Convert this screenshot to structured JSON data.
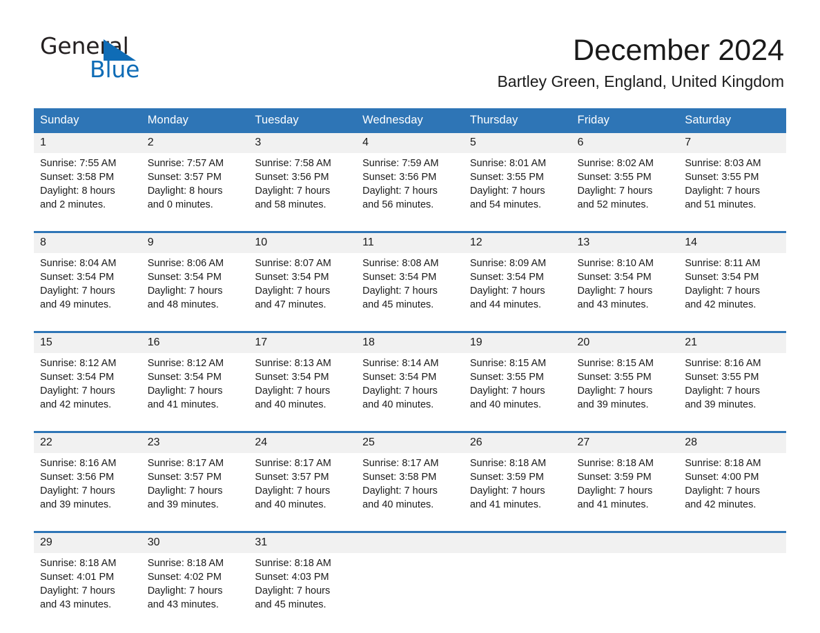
{
  "brand": {
    "name_part1": "General",
    "name_part2": "Blue",
    "accent_color": "#0f6cb6"
  },
  "header": {
    "title": "December 2024",
    "location": "Bartley Green, England, United Kingdom"
  },
  "theme": {
    "header_blue": "#2e75b6",
    "daynum_band": "#f1f1f1",
    "text": "#1a1a1a"
  },
  "weekday_headers": [
    "Sunday",
    "Monday",
    "Tuesday",
    "Wednesday",
    "Thursday",
    "Friday",
    "Saturday"
  ],
  "weeks": [
    {
      "days": [
        {
          "num": "1",
          "sunrise": "Sunrise: 7:55 AM",
          "sunset": "Sunset: 3:58 PM",
          "daylight1": "Daylight: 8 hours",
          "daylight2": "and 2 minutes."
        },
        {
          "num": "2",
          "sunrise": "Sunrise: 7:57 AM",
          "sunset": "Sunset: 3:57 PM",
          "daylight1": "Daylight: 8 hours",
          "daylight2": "and 0 minutes."
        },
        {
          "num": "3",
          "sunrise": "Sunrise: 7:58 AM",
          "sunset": "Sunset: 3:56 PM",
          "daylight1": "Daylight: 7 hours",
          "daylight2": "and 58 minutes."
        },
        {
          "num": "4",
          "sunrise": "Sunrise: 7:59 AM",
          "sunset": "Sunset: 3:56 PM",
          "daylight1": "Daylight: 7 hours",
          "daylight2": "and 56 minutes."
        },
        {
          "num": "5",
          "sunrise": "Sunrise: 8:01 AM",
          "sunset": "Sunset: 3:55 PM",
          "daylight1": "Daylight: 7 hours",
          "daylight2": "and 54 minutes."
        },
        {
          "num": "6",
          "sunrise": "Sunrise: 8:02 AM",
          "sunset": "Sunset: 3:55 PM",
          "daylight1": "Daylight: 7 hours",
          "daylight2": "and 52 minutes."
        },
        {
          "num": "7",
          "sunrise": "Sunrise: 8:03 AM",
          "sunset": "Sunset: 3:55 PM",
          "daylight1": "Daylight: 7 hours",
          "daylight2": "and 51 minutes."
        }
      ]
    },
    {
      "days": [
        {
          "num": "8",
          "sunrise": "Sunrise: 8:04 AM",
          "sunset": "Sunset: 3:54 PM",
          "daylight1": "Daylight: 7 hours",
          "daylight2": "and 49 minutes."
        },
        {
          "num": "9",
          "sunrise": "Sunrise: 8:06 AM",
          "sunset": "Sunset: 3:54 PM",
          "daylight1": "Daylight: 7 hours",
          "daylight2": "and 48 minutes."
        },
        {
          "num": "10",
          "sunrise": "Sunrise: 8:07 AM",
          "sunset": "Sunset: 3:54 PM",
          "daylight1": "Daylight: 7 hours",
          "daylight2": "and 47 minutes."
        },
        {
          "num": "11",
          "sunrise": "Sunrise: 8:08 AM",
          "sunset": "Sunset: 3:54 PM",
          "daylight1": "Daylight: 7 hours",
          "daylight2": "and 45 minutes."
        },
        {
          "num": "12",
          "sunrise": "Sunrise: 8:09 AM",
          "sunset": "Sunset: 3:54 PM",
          "daylight1": "Daylight: 7 hours",
          "daylight2": "and 44 minutes."
        },
        {
          "num": "13",
          "sunrise": "Sunrise: 8:10 AM",
          "sunset": "Sunset: 3:54 PM",
          "daylight1": "Daylight: 7 hours",
          "daylight2": "and 43 minutes."
        },
        {
          "num": "14",
          "sunrise": "Sunrise: 8:11 AM",
          "sunset": "Sunset: 3:54 PM",
          "daylight1": "Daylight: 7 hours",
          "daylight2": "and 42 minutes."
        }
      ]
    },
    {
      "days": [
        {
          "num": "15",
          "sunrise": "Sunrise: 8:12 AM",
          "sunset": "Sunset: 3:54 PM",
          "daylight1": "Daylight: 7 hours",
          "daylight2": "and 42 minutes."
        },
        {
          "num": "16",
          "sunrise": "Sunrise: 8:12 AM",
          "sunset": "Sunset: 3:54 PM",
          "daylight1": "Daylight: 7 hours",
          "daylight2": "and 41 minutes."
        },
        {
          "num": "17",
          "sunrise": "Sunrise: 8:13 AM",
          "sunset": "Sunset: 3:54 PM",
          "daylight1": "Daylight: 7 hours",
          "daylight2": "and 40 minutes."
        },
        {
          "num": "18",
          "sunrise": "Sunrise: 8:14 AM",
          "sunset": "Sunset: 3:54 PM",
          "daylight1": "Daylight: 7 hours",
          "daylight2": "and 40 minutes."
        },
        {
          "num": "19",
          "sunrise": "Sunrise: 8:15 AM",
          "sunset": "Sunset: 3:55 PM",
          "daylight1": "Daylight: 7 hours",
          "daylight2": "and 40 minutes."
        },
        {
          "num": "20",
          "sunrise": "Sunrise: 8:15 AM",
          "sunset": "Sunset: 3:55 PM",
          "daylight1": "Daylight: 7 hours",
          "daylight2": "and 39 minutes."
        },
        {
          "num": "21",
          "sunrise": "Sunrise: 8:16 AM",
          "sunset": "Sunset: 3:55 PM",
          "daylight1": "Daylight: 7 hours",
          "daylight2": "and 39 minutes."
        }
      ]
    },
    {
      "days": [
        {
          "num": "22",
          "sunrise": "Sunrise: 8:16 AM",
          "sunset": "Sunset: 3:56 PM",
          "daylight1": "Daylight: 7 hours",
          "daylight2": "and 39 minutes."
        },
        {
          "num": "23",
          "sunrise": "Sunrise: 8:17 AM",
          "sunset": "Sunset: 3:57 PM",
          "daylight1": "Daylight: 7 hours",
          "daylight2": "and 39 minutes."
        },
        {
          "num": "24",
          "sunrise": "Sunrise: 8:17 AM",
          "sunset": "Sunset: 3:57 PM",
          "daylight1": "Daylight: 7 hours",
          "daylight2": "and 40 minutes."
        },
        {
          "num": "25",
          "sunrise": "Sunrise: 8:17 AM",
          "sunset": "Sunset: 3:58 PM",
          "daylight1": "Daylight: 7 hours",
          "daylight2": "and 40 minutes."
        },
        {
          "num": "26",
          "sunrise": "Sunrise: 8:18 AM",
          "sunset": "Sunset: 3:59 PM",
          "daylight1": "Daylight: 7 hours",
          "daylight2": "and 41 minutes."
        },
        {
          "num": "27",
          "sunrise": "Sunrise: 8:18 AM",
          "sunset": "Sunset: 3:59 PM",
          "daylight1": "Daylight: 7 hours",
          "daylight2": "and 41 minutes."
        },
        {
          "num": "28",
          "sunrise": "Sunrise: 8:18 AM",
          "sunset": "Sunset: 4:00 PM",
          "daylight1": "Daylight: 7 hours",
          "daylight2": "and 42 minutes."
        }
      ]
    },
    {
      "days": [
        {
          "num": "29",
          "sunrise": "Sunrise: 8:18 AM",
          "sunset": "Sunset: 4:01 PM",
          "daylight1": "Daylight: 7 hours",
          "daylight2": "and 43 minutes."
        },
        {
          "num": "30",
          "sunrise": "Sunrise: 8:18 AM",
          "sunset": "Sunset: 4:02 PM",
          "daylight1": "Daylight: 7 hours",
          "daylight2": "and 43 minutes."
        },
        {
          "num": "31",
          "sunrise": "Sunrise: 8:18 AM",
          "sunset": "Sunset: 4:03 PM",
          "daylight1": "Daylight: 7 hours",
          "daylight2": "and 45 minutes."
        },
        {
          "num": "",
          "sunrise": "",
          "sunset": "",
          "daylight1": "",
          "daylight2": ""
        },
        {
          "num": "",
          "sunrise": "",
          "sunset": "",
          "daylight1": "",
          "daylight2": ""
        },
        {
          "num": "",
          "sunrise": "",
          "sunset": "",
          "daylight1": "",
          "daylight2": ""
        },
        {
          "num": "",
          "sunrise": "",
          "sunset": "",
          "daylight1": "",
          "daylight2": ""
        }
      ]
    }
  ]
}
